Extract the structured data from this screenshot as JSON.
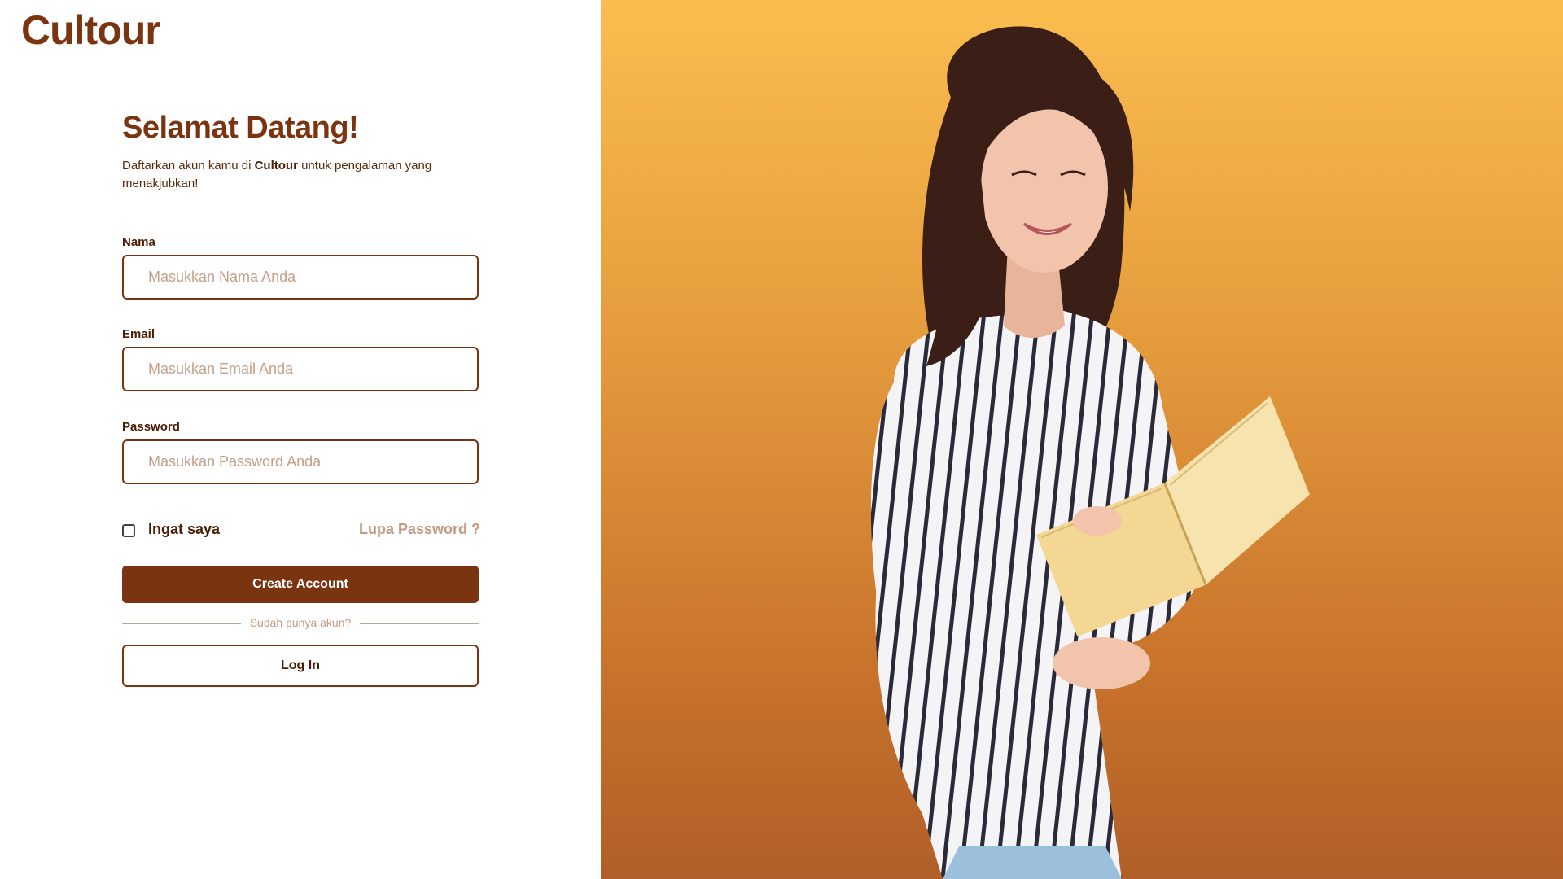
{
  "brand": {
    "name": "Cultour"
  },
  "welcome": {
    "heading": "Selamat Datang!",
    "subtitle_prefix": "Daftarkan akun kamu di ",
    "subtitle_brand": "Cultour",
    "subtitle_suffix": " untuk pengalaman yang menakjubkan!"
  },
  "form": {
    "name": {
      "label": "Nama",
      "placeholder": "Masukkan Nama Anda",
      "value": ""
    },
    "email": {
      "label": "Email",
      "placeholder": "Masukkan Email Anda",
      "value": ""
    },
    "password": {
      "label": "Password",
      "placeholder": "Masukkan Password Anda",
      "value": ""
    },
    "remember_label": "Ingat saya",
    "remember_checked": false,
    "forgot_label": "Lupa Password ?",
    "create_label": "Create Account",
    "divider_label": "Sudah punya akun?",
    "login_label": "Log In"
  },
  "colors": {
    "primary": "#7a3510",
    "muted": "#c09a82",
    "hero_top": "#fbbd4f",
    "hero_bottom": "#b05f28"
  }
}
